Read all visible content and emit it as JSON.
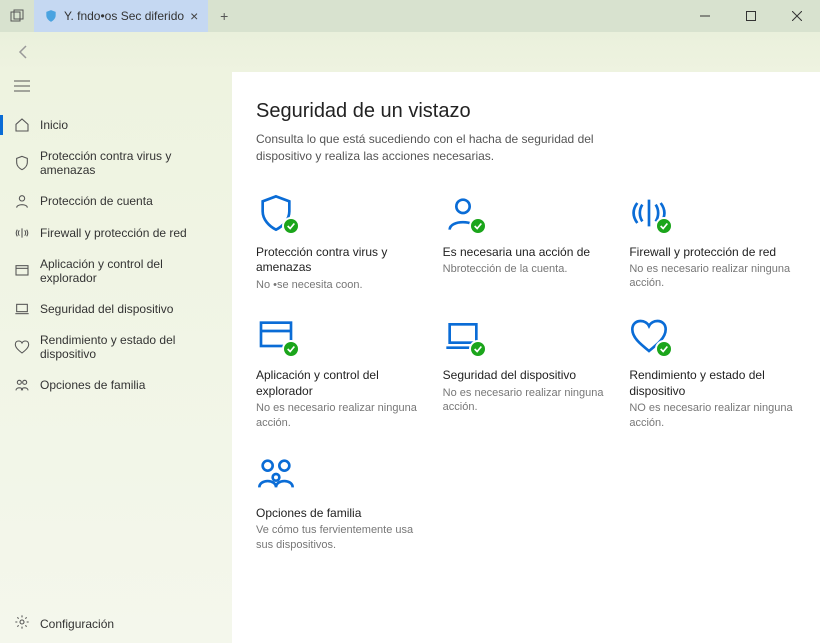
{
  "titlebar": {
    "tab_title": "Y. fndo•os Sec diferido"
  },
  "sidebar": {
    "items": [
      {
        "label": "Inicio"
      },
      {
        "label": "Protección contra virus y amenazas"
      },
      {
        "label": "Protección de cuenta"
      },
      {
        "label": "Firewall y protección de red"
      },
      {
        "label": "Aplicación y control del explorador"
      },
      {
        "label": "Seguridad del dispositivo"
      },
      {
        "label": "Rendimiento y estado del dispositivo"
      },
      {
        "label": "Opciones de familia"
      }
    ],
    "settings": "Configuración"
  },
  "main": {
    "title": "Seguridad de un vistazo",
    "subtitle": "Consulta lo que está sucediendo con el hacha de seguridad del dispositivo y realiza las acciones necesarias."
  },
  "cards": [
    {
      "title": "Protección contra virus y amenazas",
      "desc": "No •se necesita coon."
    },
    {
      "title": "Es necesaria una acción de",
      "desc": "Nbrotección de la cuenta."
    },
    {
      "title": "Firewall y protección de red",
      "desc": "No es necesario realizar ninguna acción."
    },
    {
      "title": "Aplicación y control del explorador",
      "desc": "No es necesario realizar ninguna acción."
    },
    {
      "title": "Seguridad del dispositivo",
      "desc": "No es necesario realizar ninguna acción."
    },
    {
      "title": "Rendimiento y estado del dispositivo",
      "desc": "NO es necesario realizar ninguna acción."
    },
    {
      "title": "Opciones de familia",
      "desc": "Ve cómo tus fervientemente usa sus dispositivos."
    }
  ]
}
